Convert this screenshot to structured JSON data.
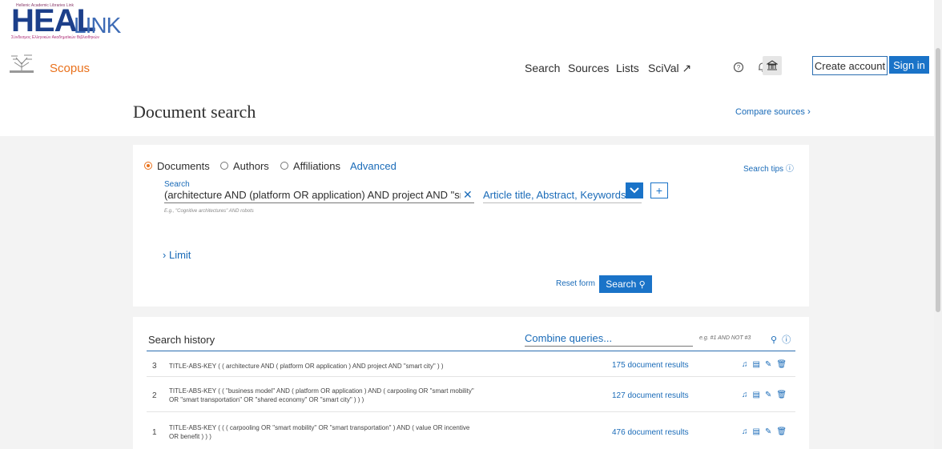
{
  "header": {
    "heal_small": "Hellenic Academic Libraries Link",
    "heal_big": "HEAL",
    "heal_link": "LINK",
    "heal_subtitle": "Σύνδεσμος Ελληνικών Ακαδημαϊκών Βιβλιοθηκών",
    "app_name": "Scopus",
    "nav": [
      "Search",
      "Sources",
      "Lists",
      "SciVal ↗"
    ],
    "create_account": "Create account",
    "sign_in": "Sign in"
  },
  "page": {
    "title": "Document search",
    "compare_sources": "Compare sources"
  },
  "search_form": {
    "tabs": [
      {
        "label": "Documents",
        "selected": true
      },
      {
        "label": "Authors",
        "selected": false
      },
      {
        "label": "Affiliations",
        "selected": false
      }
    ],
    "advanced": "Advanced",
    "search_tips": "Search tips",
    "search_label": "Search",
    "search_value": "(architecture AND (platform OR application) AND project AND \"smart city\")",
    "hint": "E.g., \"Cognitive architectures\" AND robots",
    "field": "Article title, Abstract, Keywords",
    "limit": "Limit",
    "reset": "Reset form",
    "search_button": "Search"
  },
  "history": {
    "title": "Search history",
    "combine_placeholder": "Combine queries...",
    "combine_example": "e.g. #1 AND NOT #3",
    "rows": [
      {
        "num": "3",
        "line1": "TITLE-ABS-KEY ( ( architecture  AND  ( platform  OR  application ) AND  project  AND  \"smart city\" ) )",
        "line2": "",
        "results": "175 document results"
      },
      {
        "num": "2",
        "line1": "TITLE-ABS-KEY ( ( \"business model\"  AND  ( platform  OR  application ) AND  ( carpooling  OR  \"smart mobility\"",
        "line2": "OR  \"smart transportation\"  OR  \"shared economy\"  OR  \"smart city\" ) ) )",
        "results": "127 document results"
      },
      {
        "num": "1",
        "line1": "TITLE-ABS-KEY ( ( ( carpooling  OR  \"smart mobility\"  OR  \"smart transportation\" ) AND  ( value  OR  incentive",
        "line2": "OR  benefit ) ) )",
        "results": "476 document results"
      }
    ]
  }
}
